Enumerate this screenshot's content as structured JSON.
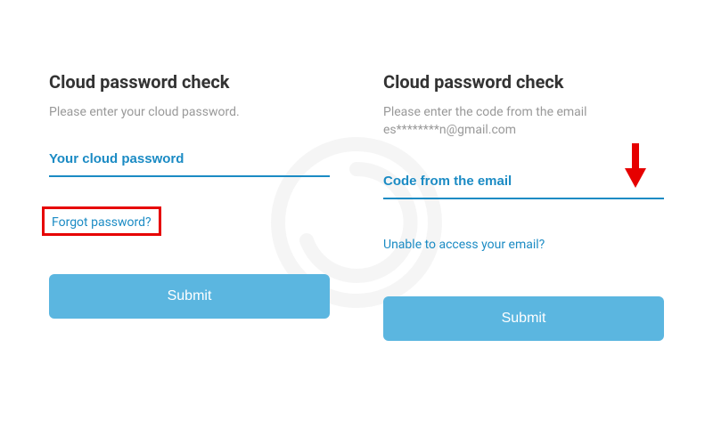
{
  "left": {
    "title": "Cloud password check",
    "subtitle": "Please enter your cloud password.",
    "input_placeholder": "Your cloud password",
    "link_label": "Forgot password?",
    "submit_label": "Submit"
  },
  "right": {
    "title": "Cloud password check",
    "subtitle": "Please enter the code from the email\nes********n@gmail.com",
    "input_placeholder": "Code from the email",
    "link_label": "Unable to access your email?",
    "submit_label": "Submit"
  },
  "annotations": {
    "arrow": "red-down-arrow",
    "highlight_box": "red"
  }
}
